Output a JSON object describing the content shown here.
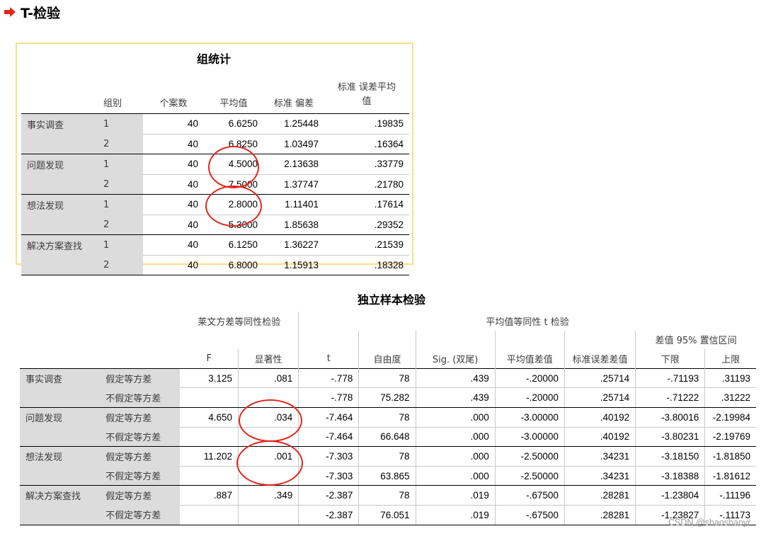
{
  "header": {
    "title": "T-检验"
  },
  "group_stats": {
    "caption": "组统计",
    "columns": [
      "组别",
      "个案数",
      "平均值",
      "标准 偏差",
      "标准 误差平均\n值"
    ],
    "rows": [
      {
        "var": "事实调查",
        "group": "1",
        "n": "40",
        "mean": "6.6250",
        "sd": "1.25448",
        "se": ".19835"
      },
      {
        "var": "",
        "group": "2",
        "n": "40",
        "mean": "6.8250",
        "sd": "1.03497",
        "se": ".16364"
      },
      {
        "var": "问题发现",
        "group": "1",
        "n": "40",
        "mean": "4.5000",
        "sd": "2.13638",
        "se": ".33779"
      },
      {
        "var": "",
        "group": "2",
        "n": "40",
        "mean": "7.5000",
        "sd": "1.37747",
        "se": ".21780"
      },
      {
        "var": "想法发现",
        "group": "1",
        "n": "40",
        "mean": "2.8000",
        "sd": "1.11401",
        "se": ".17614"
      },
      {
        "var": "",
        "group": "2",
        "n": "40",
        "mean": "5.3000",
        "sd": "1.85638",
        "se": ".29352"
      },
      {
        "var": "解决方案查找",
        "group": "1",
        "n": "40",
        "mean": "6.1250",
        "sd": "1.36227",
        "se": ".21539"
      },
      {
        "var": "",
        "group": "2",
        "n": "40",
        "mean": "6.8000",
        "sd": "1.15913",
        "se": ".18328"
      }
    ]
  },
  "ind_test": {
    "caption": "独立样本检验",
    "levene_header": "莱文方差等同性检验",
    "ttest_header": "平均值等同性 t 检验",
    "ci_header": "差值 95% 置信区间",
    "columns": [
      "F",
      "显著性",
      "t",
      "自由度",
      "Sig. (双尾)",
      "平均值差值",
      "标准误差差值",
      "下限",
      "上限"
    ],
    "rows": [
      {
        "var": "事实调查",
        "assume": "假定等方差",
        "F": "3.125",
        "sig": ".081",
        "t": "-.778",
        "df": "78",
        "p": ".439",
        "md": "-.20000",
        "sed": ".25714",
        "lo": "-.71193",
        "hi": ".31193"
      },
      {
        "var": "",
        "assume": "不假定等方差",
        "F": "",
        "sig": "",
        "t": "-.778",
        "df": "75.282",
        "p": ".439",
        "md": "-.20000",
        "sed": ".25714",
        "lo": "-.71222",
        "hi": ".31222"
      },
      {
        "var": "问题发现",
        "assume": "假定等方差",
        "F": "4.650",
        "sig": ".034",
        "t": "-7.464",
        "df": "78",
        "p": ".000",
        "md": "-3.00000",
        "sed": ".40192",
        "lo": "-3.80016",
        "hi": "-2.19984"
      },
      {
        "var": "",
        "assume": "不假定等方差",
        "F": "",
        "sig": "",
        "t": "-7.464",
        "df": "66.648",
        "p": ".000",
        "md": "-3.00000",
        "sed": ".40192",
        "lo": "-3.80231",
        "hi": "-2.19769"
      },
      {
        "var": "想法发现",
        "assume": "假定等方差",
        "F": "11.202",
        "sig": ".001",
        "t": "-7.303",
        "df": "78",
        "p": ".000",
        "md": "-2.50000",
        "sed": ".34231",
        "lo": "-3.18150",
        "hi": "-1.81850"
      },
      {
        "var": "",
        "assume": "不假定等方差",
        "F": "",
        "sig": "",
        "t": "-7.303",
        "df": "63.865",
        "p": ".000",
        "md": "-2.50000",
        "sed": ".34231",
        "lo": "-3.18388",
        "hi": "-1.81612"
      },
      {
        "var": "解决方案查找",
        "assume": "假定等方差",
        "F": ".887",
        "sig": ".349",
        "t": "-2.387",
        "df": "78",
        "p": ".019",
        "md": "-.67500",
        "sed": ".28281",
        "lo": "-1.23804",
        "hi": "-.11196"
      },
      {
        "var": "",
        "assume": "不假定等方差",
        "F": "",
        "sig": "",
        "t": "-2.387",
        "df": "76.051",
        "p": ".019",
        "md": "-.67500",
        "sed": ".28281",
        "lo": "-1.23827",
        "hi": "-.11173"
      }
    ]
  },
  "annotation_color": "#e0271d",
  "watermark": "CSDN @shaoshaoyr"
}
